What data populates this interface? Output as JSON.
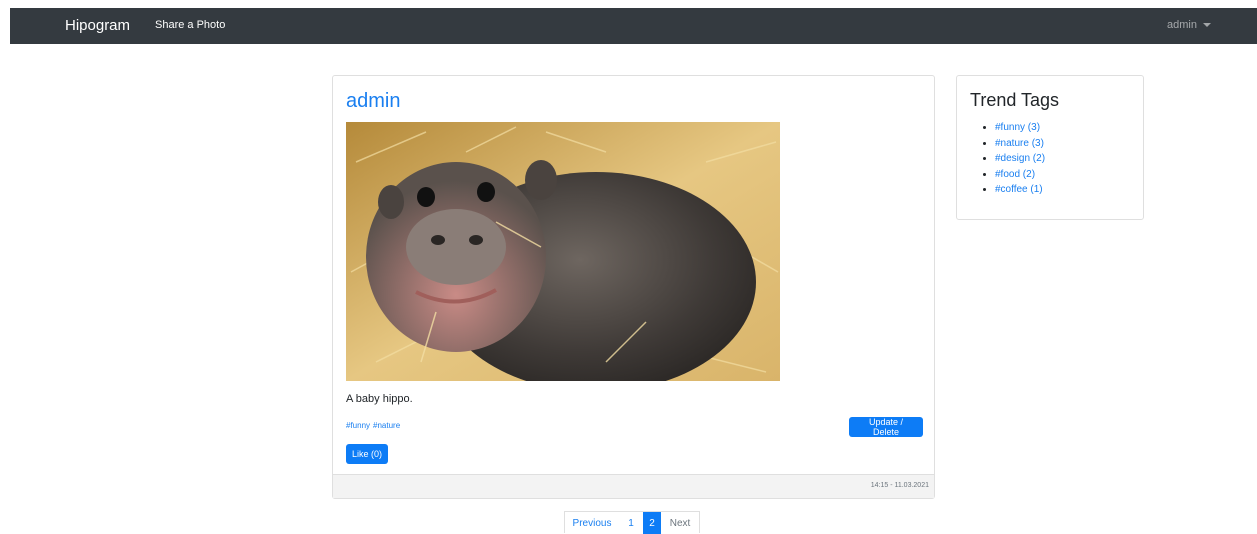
{
  "navbar": {
    "brand": "Hipogram",
    "share_link": "Share a Photo",
    "user": "admin"
  },
  "post": {
    "author": "admin",
    "caption": "A baby hippo.",
    "tags": [
      "#funny",
      "#nature"
    ],
    "update_label": "Update / Delete",
    "like_label": "Like (0)",
    "timestamp": "14:15 - 11.03.2021"
  },
  "trends": {
    "title": "Trend Tags",
    "items": [
      "#funny (3)",
      "#nature (3)",
      "#design (2)",
      "#food (2)",
      "#coffee (1)"
    ]
  },
  "pagination": {
    "prev": "Previous",
    "pages": [
      "1",
      "2"
    ],
    "current": "2",
    "next": "Next"
  },
  "colors": {
    "navbar": "#343a40",
    "primary": "#0d7cf6",
    "link": "#1a7ff0"
  }
}
